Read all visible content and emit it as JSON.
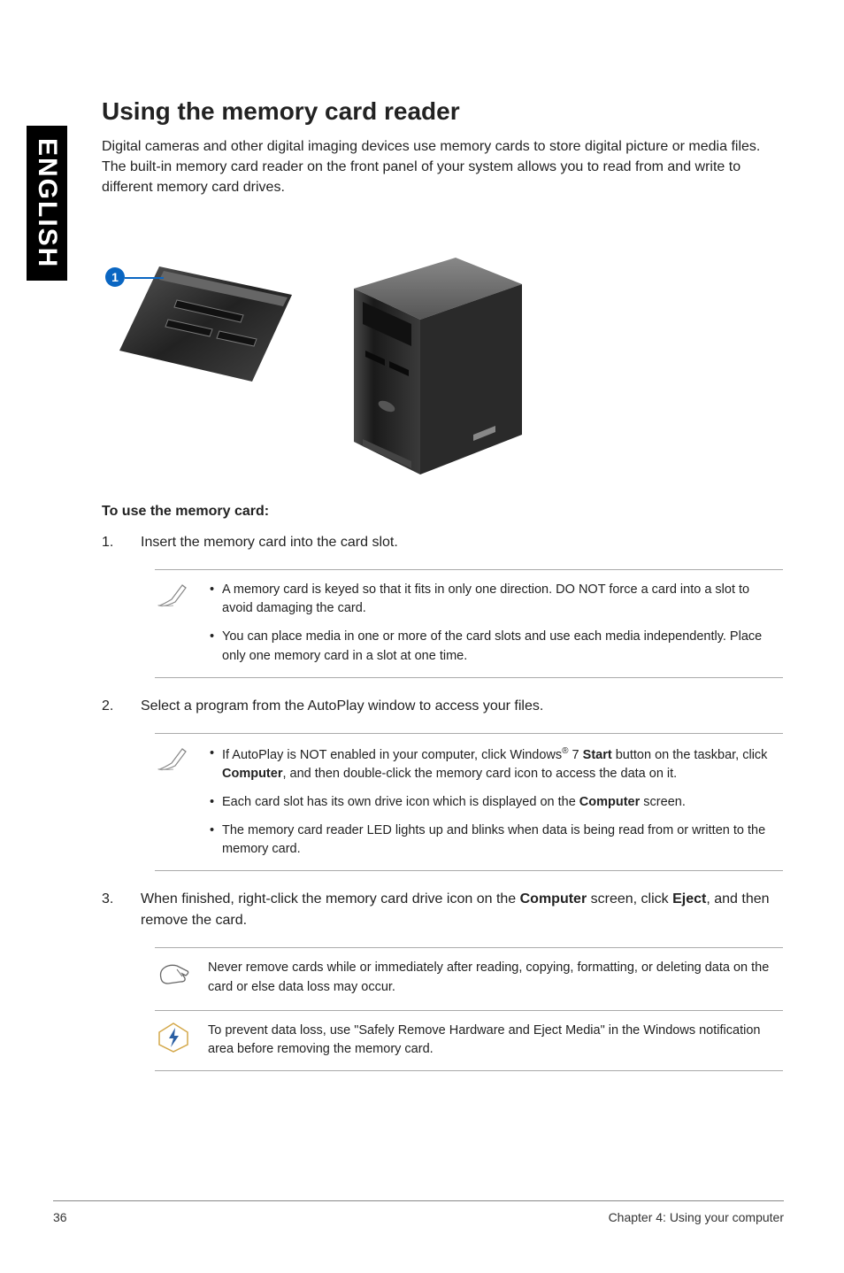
{
  "side_tab": "ENGLISH",
  "title": "Using the memory card reader",
  "intro": "Digital cameras and other digital imaging devices use memory cards to store digital picture or media files. The built-in memory card reader on the front panel of your system allows you to read from and write to different memory card drives.",
  "callout_number": "1",
  "subhead": "To use the memory card:",
  "step1_num": "1.",
  "step1_text": "Insert the memory card into the card slot.",
  "note1_a": "A memory card is keyed so that it fits in only one direction. DO NOT force a card into a slot to avoid damaging the card.",
  "note1_b": "You can place media in one or more of the card slots and use each media independently. Place only one memory card in a slot at one time.",
  "step2_num": "2.",
  "step2_text": "Select a program from the AutoPlay window to access your files.",
  "note2_a_pre": "If AutoPlay is NOT enabled in your computer, click Windows",
  "note2_a_sup": "®",
  "note2_a_mid": " 7 ",
  "note2_a_bold1": "Start",
  "note2_a_post1": " button on the taskbar, click ",
  "note2_a_bold2": "Computer",
  "note2_a_post2": ", and then double-click the memory card icon to access the data on it.",
  "note2_b_pre": "Each card slot has its own drive icon which is displayed on the ",
  "note2_b_bold": "Computer",
  "note2_b_post": " screen.",
  "note2_c": "The memory card reader LED lights up and blinks when data is being read from or written to the memory card.",
  "step3_num": "3.",
  "step3_pre": "When finished, right-click the memory card drive icon on the ",
  "step3_bold1": "Computer",
  "step3_mid": " screen, click ",
  "step3_bold2": "Eject",
  "step3_post": ", and then remove the card.",
  "warn1": "Never remove cards while or immediately after reading, copying, formatting, or deleting data on the card or else data loss may occur.",
  "warn2": "To prevent data loss, use \"Safely Remove Hardware and Eject Media\" in the Windows notification area before removing the memory card.",
  "footer_left": "36",
  "footer_right": "Chapter 4: Using your computer"
}
